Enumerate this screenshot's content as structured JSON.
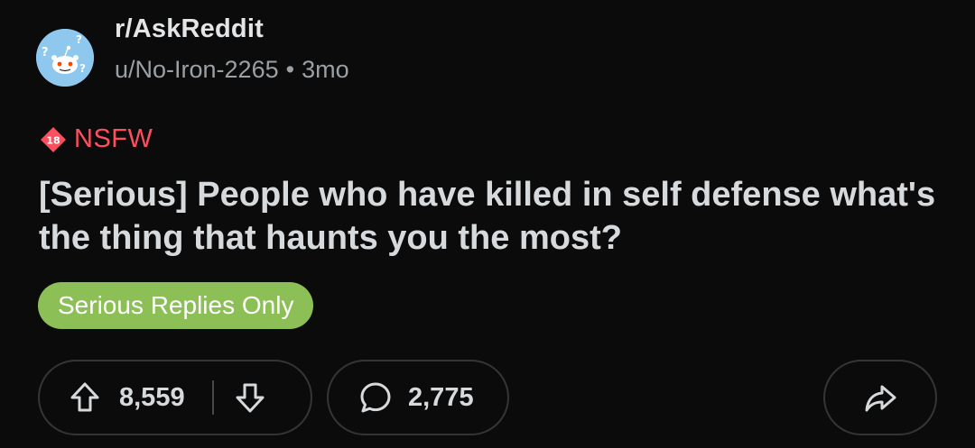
{
  "post": {
    "subreddit": "r/AskReddit",
    "author": "u/No-Iron-2265",
    "separator": "•",
    "age": "3mo",
    "nsfw_badge_text": "18",
    "nsfw_label": "NSFW",
    "title": "[Serious] People who have killed in self defense what's the thing that haunts you the most?",
    "flair": "Serious Replies Only",
    "vote_count": "8,559",
    "comment_count": "2,775"
  },
  "icons": {
    "avatar": "askreddit-snoo-icon",
    "nsfw": "nsfw-18-badge-icon",
    "upvote": "upvote-arrow-icon",
    "downvote": "downvote-arrow-icon",
    "comment": "comment-bubble-icon",
    "share": "share-arrow-icon"
  },
  "colors": {
    "background": "#0b0b0b",
    "nsfw_red": "#ff4f5e",
    "flair_green": "#8cbf56",
    "avatar_blue": "#8ec8ef",
    "pill_border": "#343536"
  }
}
